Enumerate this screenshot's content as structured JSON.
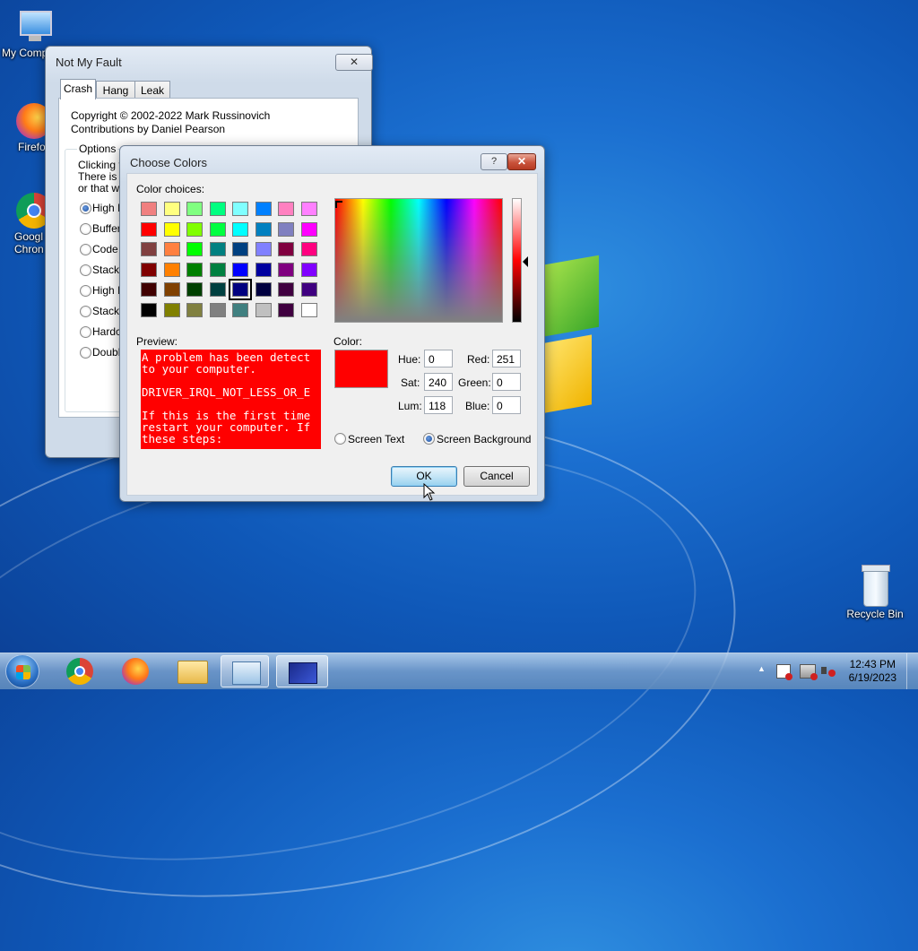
{
  "desktop": {
    "icons": [
      {
        "label": "My Comp"
      },
      {
        "label": "Firefo"
      },
      {
        "label": "Googl\nChron"
      },
      {
        "label": "Recycle Bin"
      }
    ]
  },
  "notmyfault": {
    "title": "Not My Fault",
    "close": "✕",
    "tabs": [
      "Crash",
      "Hang",
      "Leak"
    ],
    "copyright": "Copyright © 2002-2022 Mark Russinovich",
    "contributions": "Contributions by Daniel Pearson",
    "options_label": "Options",
    "options_text": [
      "Clicking th",
      "There is a",
      "or that wo"
    ],
    "radios": [
      "High IR",
      "Buffer",
      "Code c",
      "Stack",
      "High IR",
      "Stack",
      "Hardco",
      "Double"
    ]
  },
  "dialog": {
    "title": "Choose Colors",
    "help": "?",
    "close": "✕",
    "color_choices_label": "Color choices:",
    "swatches": [
      [
        "#f08080",
        "#ffff80",
        "#80ff80",
        "#00ff80",
        "#80ffff",
        "#0080ff",
        "#ff80c0",
        "#ff80ff"
      ],
      [
        "#ff0000",
        "#ffff00",
        "#80ff00",
        "#00ff40",
        "#00ffff",
        "#0080c0",
        "#8080c0",
        "#ff00ff"
      ],
      [
        "#804040",
        "#ff8040",
        "#00ff00",
        "#008080",
        "#004080",
        "#8080ff",
        "#800040",
        "#ff0080"
      ],
      [
        "#800000",
        "#ff8000",
        "#008000",
        "#008040",
        "#0000ff",
        "#0000a0",
        "#800080",
        "#8000ff"
      ],
      [
        "#400000",
        "#804000",
        "#004000",
        "#004040",
        "#000080",
        "#000040",
        "#400040",
        "#400080"
      ],
      [
        "#000000",
        "#808000",
        "#808040",
        "#808080",
        "#408080",
        "#c0c0c0",
        "#400040",
        "#ffffff"
      ]
    ],
    "selected_swatch": "#000080",
    "preview_label": "Preview:",
    "preview_text": "A problem has been detect\nto your computer.\n\nDRIVER_IRQL_NOT_LESS_OR_E\n\nIf this is the first time\nrestart your computer. If\nthese steps:",
    "color_label": "Color:",
    "current_color": "#ff0000",
    "hue_label": "Hue:",
    "hue": "0",
    "sat_label": "Sat:",
    "sat": "240",
    "lum_label": "Lum:",
    "lum": "118",
    "red_label": "Red:",
    "red": "251",
    "green_label": "Green:",
    "green": "0",
    "blue_label": "Blue:",
    "blue": "0",
    "screen_text_label": "Screen Text",
    "screen_background_label": "Screen Background",
    "ok_label": "OK",
    "cancel_label": "Cancel"
  },
  "taskbar": {
    "time": "12:43 PM",
    "date": "6/19/2023",
    "tray_arrow": "▲"
  }
}
